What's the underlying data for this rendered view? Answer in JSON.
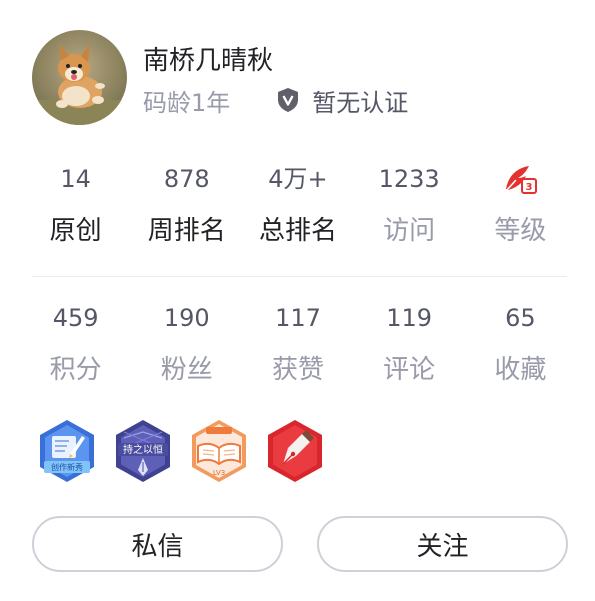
{
  "profile": {
    "name": "南桥几晴秋",
    "code_age": "码龄1年",
    "certification": "暂无认证",
    "avatar_icon": "corgi-dog-avatar"
  },
  "stats_row1": [
    {
      "value": "14",
      "label": "原创"
    },
    {
      "value": "878",
      "label": "周排名"
    },
    {
      "value": "4万+",
      "label": "总排名"
    },
    {
      "value": "1233",
      "label": "访问"
    },
    {
      "value": "",
      "label": "等级",
      "icon": "level-quill-icon"
    }
  ],
  "stats_row2": [
    {
      "value": "459",
      "label": "积分"
    },
    {
      "value": "190",
      "label": "粉丝"
    },
    {
      "value": "117",
      "label": "获赞"
    },
    {
      "value": "119",
      "label": "评论"
    },
    {
      "value": "65",
      "label": "收藏"
    }
  ],
  "badges": [
    {
      "icon": "creation-newcomer-badge-icon",
      "text": "创作新秀"
    },
    {
      "icon": "persistence-badge-icon",
      "text": "持之以恒"
    },
    {
      "icon": "reading-badge-icon",
      "text": "LV3"
    },
    {
      "icon": "pen-badge-icon",
      "text": ""
    }
  ],
  "actions": {
    "message_label": "私信",
    "follow_label": "关注"
  },
  "colors": {
    "text_primary": "#222226",
    "text_secondary": "#999aaa",
    "text_number": "#555666",
    "level_red": "#e5312f",
    "button_border": "#cfd0d8"
  }
}
